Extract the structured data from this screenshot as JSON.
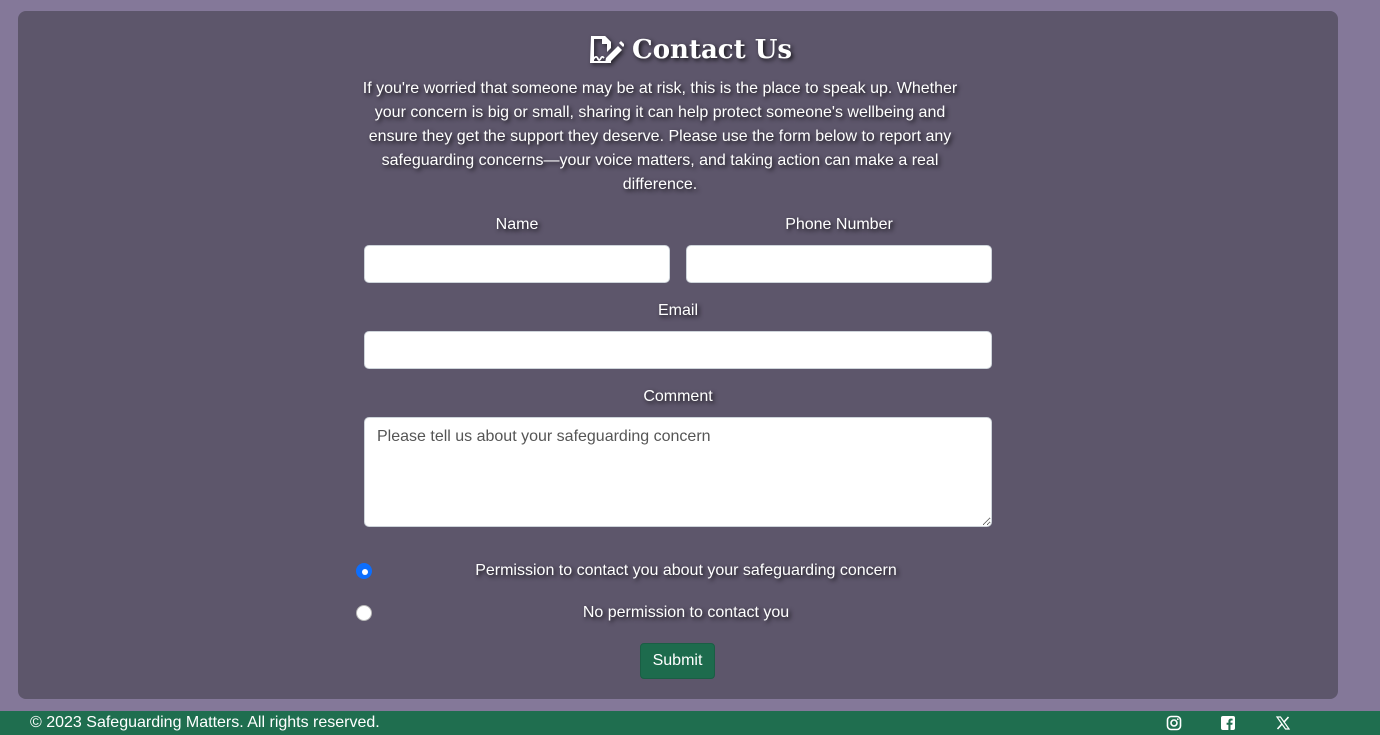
{
  "header": {
    "title": "Contact Us",
    "icon": "file-signature-icon"
  },
  "intro": "If you're worried that someone may be at risk, this is the place to speak up. Whether your concern is big or small, sharing it can help protect someone's wellbeing and ensure they get the support they deserve. Please use the form below to report any safeguarding concerns—your voice matters, and taking action can make a real difference.",
  "form": {
    "name_label": "Name",
    "name_value": "",
    "phone_label": "Phone Number",
    "phone_value": "",
    "email_label": "Email",
    "email_value": "",
    "comment_label": "Comment",
    "comment_placeholder": "Please tell us about your safeguarding concern",
    "radio_permission_label": "Permission to contact you about your safeguarding concern",
    "radio_permission_checked": true,
    "radio_no_permission_label": "No permission to contact you",
    "radio_no_permission_checked": false,
    "submit_label": "Submit"
  },
  "footer": {
    "copyright": "© 2023 Safeguarding Matters. All rights reserved.",
    "social_icons": [
      "instagram-icon",
      "facebook-icon",
      "x-twitter-icon"
    ]
  },
  "colors": {
    "page_bg": "#847899",
    "panel_bg": "#5d566b",
    "accent_green": "#1f6e4f",
    "radio_checked": "#0d6efd"
  }
}
